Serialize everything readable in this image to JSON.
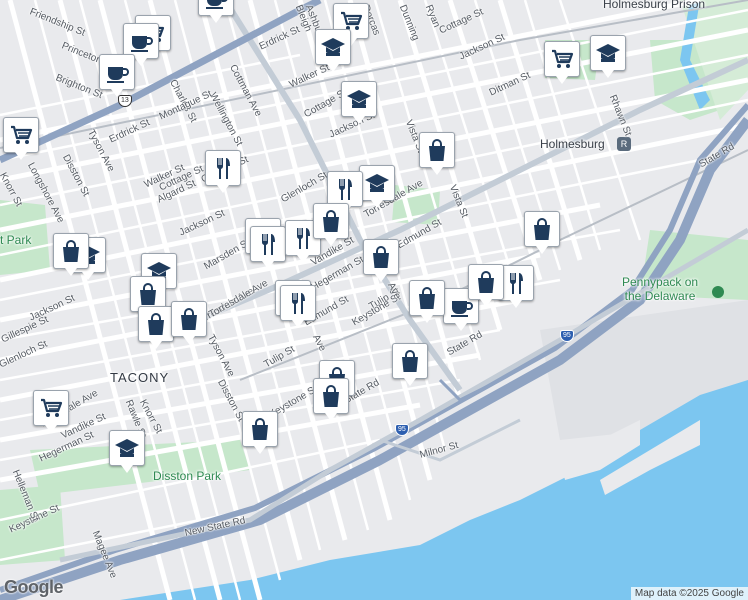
{
  "map": {
    "neighborhoods": {
      "tacony": "TACONY",
      "holmesburg": "Holmesburg",
      "holmesburg_prison": "Holmesburg Prison"
    },
    "parks": {
      "disston_park": "Disston Park",
      "left_park": "t Park"
    },
    "poi": {
      "pennypack": "Pennypack on\nthe Delaware"
    },
    "highways": {
      "i95": "95",
      "us13": "13"
    },
    "streets": [
      "Cottman Ave",
      "Torresdale Ave",
      "Torresdale Ave",
      "Torresdale Ave",
      "Torresdale Ave",
      "Tyson Ave",
      "Tyson Ave",
      "Disston St",
      "Disston St",
      "Longshore Ave",
      "Knorr St",
      "Knorr St",
      "Princeton Ave",
      "Brighton St",
      "Friendship St",
      "Charles St",
      "Wellington St",
      "Montague St",
      "Erdrick St",
      "Erdrick St",
      "Walker St",
      "Walker St",
      "Algard St",
      "Cottage St",
      "Cottage St",
      "Cottage St",
      "Gillespie St",
      "Gillespie St",
      "Jackson St",
      "Jackson St",
      "Jackson St",
      "Jackson St",
      "Glenloch St",
      "Glenloch St",
      "Marsden St",
      "Vandike St",
      "Vandike St",
      "Hegerman St",
      "Hegerman St",
      "Edmund St",
      "Edmund St",
      "Tulip St",
      "Tulip St",
      "Keystone St",
      "Keystone St",
      "Keystone St",
      "State Rd",
      "State Rd",
      "State Rd",
      "New State Rd",
      "Milnor St",
      "Ditman St",
      "Rhawn St",
      "Vista St",
      "Vista St",
      "Bleigh",
      "Magee Ave",
      "Helleman St",
      "Rawle St",
      "Ashburner",
      "Dorcas",
      "Dunning",
      "Ryan",
      "Ave",
      "Ave"
    ],
    "google_logo": "Google",
    "attribution": "Map data ©2025 Google",
    "rail_icon": "R"
  },
  "markers": [
    {
      "type": "cart"
    },
    {
      "type": "cart"
    },
    {
      "type": "cart"
    },
    {
      "type": "cart"
    },
    {
      "type": "cart"
    },
    {
      "type": "cup"
    },
    {
      "type": "cup"
    },
    {
      "type": "cup"
    },
    {
      "type": "cup"
    },
    {
      "type": "cap"
    },
    {
      "type": "cap"
    },
    {
      "type": "cap"
    },
    {
      "type": "cap"
    },
    {
      "type": "cap"
    },
    {
      "type": "cap"
    },
    {
      "type": "cap"
    },
    {
      "type": "food"
    },
    {
      "type": "food"
    },
    {
      "type": "food"
    },
    {
      "type": "food"
    },
    {
      "type": "food"
    },
    {
      "type": "food"
    },
    {
      "type": "food"
    },
    {
      "type": "food"
    },
    {
      "type": "bag"
    },
    {
      "type": "bag"
    },
    {
      "type": "bag"
    },
    {
      "type": "bag"
    },
    {
      "type": "bag"
    },
    {
      "type": "bag"
    },
    {
      "type": "bag"
    },
    {
      "type": "bag"
    },
    {
      "type": "bag"
    },
    {
      "type": "bag"
    },
    {
      "type": "bag"
    },
    {
      "type": "bag"
    },
    {
      "type": "bag"
    },
    {
      "type": "bag"
    }
  ],
  "colors": {
    "land": "#e9eaed",
    "road": "#ffffff",
    "highway": "#8fa3c2",
    "water": "#7cc6f0",
    "park": "#c6e7cb",
    "pin_icon": "#1f3b5c"
  }
}
